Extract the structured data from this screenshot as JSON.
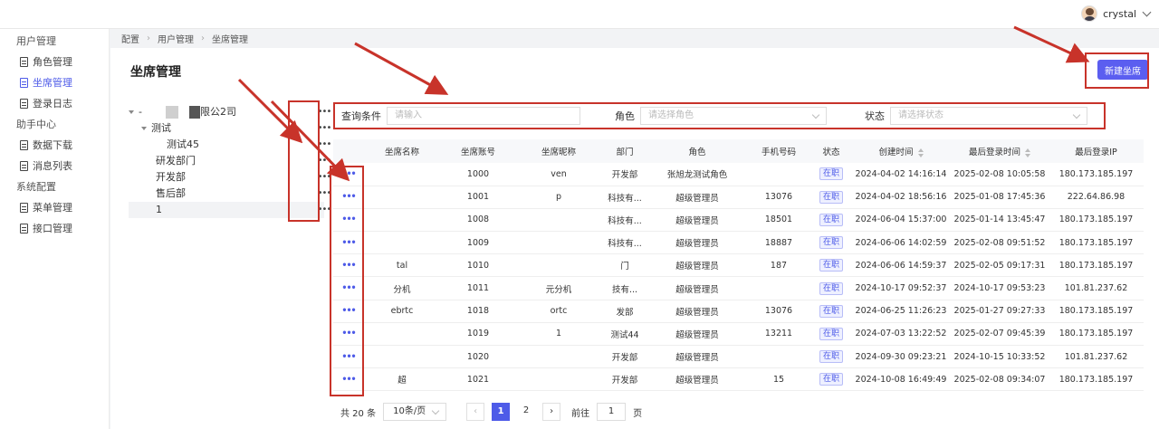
{
  "header": {
    "username": "crystal"
  },
  "sidebar": {
    "groups": [
      {
        "label": "用户管理",
        "items": [
          {
            "label": "角色管理",
            "active": false
          },
          {
            "label": "坐席管理",
            "active": true
          },
          {
            "label": "登录日志",
            "active": false
          }
        ]
      },
      {
        "label": "助手中心",
        "items": [
          {
            "label": "数据下载",
            "active": false
          },
          {
            "label": "消息列表",
            "active": false
          }
        ]
      },
      {
        "label": "系统配置",
        "items": [
          {
            "label": "菜单管理",
            "active": false
          },
          {
            "label": "接口管理",
            "active": false
          }
        ]
      }
    ]
  },
  "breadcrumb": [
    "配置",
    "用户管理",
    "坐席管理"
  ],
  "page": {
    "title": "坐席管理",
    "new_button": "新建坐席"
  },
  "tree": [
    {
      "label": "-",
      "suffix": "限公2司",
      "level": 0,
      "expanded": true,
      "selected": false
    },
    {
      "label": "测试",
      "level": 1,
      "expanded": true,
      "selected": false
    },
    {
      "label": "测试45",
      "level": 2,
      "selected": false
    },
    {
      "label": "研发部门",
      "level": 1,
      "selected": false
    },
    {
      "label": "开发部",
      "level": 1,
      "selected": false
    },
    {
      "label": "售后部",
      "level": 1,
      "selected": false
    },
    {
      "label": "1",
      "level": 1,
      "selected": true
    }
  ],
  "filter": {
    "query_label": "查询条件",
    "query_placeholder": "请输入",
    "role_label": "角色",
    "role_placeholder": "请选择角色",
    "status_label": "状态",
    "status_placeholder": "请选择状态"
  },
  "table": {
    "columns": [
      "",
      "坐席名称",
      "坐席账号",
      "坐席昵称",
      "部门",
      "角色",
      "手机号码",
      "状态",
      "创建时间",
      "最后登录时间",
      "最后登录IP"
    ],
    "rows": [
      {
        "more": "•••",
        "name": "",
        "account": "1000",
        "nickname": "ven",
        "dept": "开发部",
        "role": "张旭龙测试角色",
        "phone": "",
        "status": "在职",
        "created": "2024-04-02 14:16:14",
        "last_login": "2025-02-08 10:05:58",
        "ip": "180.173.185.197"
      },
      {
        "more": "•••",
        "name": "",
        "account": "1001",
        "nickname": "p",
        "dept": "科技有...",
        "role": "超级管理员",
        "phone": "13076",
        "status": "在职",
        "created": "2024-04-02 18:56:16",
        "last_login": "2025-01-08 17:45:36",
        "ip": "222.64.86.98"
      },
      {
        "more": "•••",
        "name": "",
        "account": "1008",
        "nickname": "",
        "dept": "科技有...",
        "role": "超级管理员",
        "phone": "18501",
        "status": "在职",
        "created": "2024-06-04 15:37:00",
        "last_login": "2025-01-14 13:45:47",
        "ip": "180.173.185.197"
      },
      {
        "more": "•••",
        "name": "",
        "account": "1009",
        "nickname": "",
        "dept": "科技有...",
        "role": "超级管理员",
        "phone": "18887",
        "status": "在职",
        "created": "2024-06-06 14:02:59",
        "last_login": "2025-02-08 09:51:52",
        "ip": "180.173.185.197"
      },
      {
        "more": "•••",
        "name": "tal",
        "account": "1010",
        "nickname": "",
        "dept": "门",
        "role": "超级管理员",
        "phone": "187",
        "status": "在职",
        "created": "2024-06-06 14:59:37",
        "last_login": "2025-02-05 09:17:31",
        "ip": "180.173.185.197"
      },
      {
        "more": "•••",
        "name": "分机",
        "account": "1011",
        "nickname": "元分机",
        "dept": "技有...",
        "role": "超级管理员",
        "phone": "",
        "status": "在职",
        "created": "2024-10-17 09:52:37",
        "last_login": "2024-10-17 09:53:23",
        "ip": "101.81.237.62"
      },
      {
        "more": "•••",
        "name": "ebrtc",
        "account": "1018",
        "nickname": "ortc",
        "dept": "发部",
        "role": "超级管理员",
        "phone": "13076",
        "status": "在职",
        "created": "2024-06-25 11:26:23",
        "last_login": "2025-01-27 09:27:33",
        "ip": "180.173.185.197"
      },
      {
        "more": "•••",
        "name": "",
        "account": "1019",
        "nickname": "1",
        "dept": "测试44",
        "role": "超级管理员",
        "phone": "13211",
        "status": "在职",
        "created": "2024-07-03 13:22:52",
        "last_login": "2025-02-07 09:45:39",
        "ip": "180.173.185.197"
      },
      {
        "more": "•••",
        "name": "",
        "account": "1020",
        "nickname": "",
        "dept": "开发部",
        "role": "超级管理员",
        "phone": "",
        "status": "在职",
        "created": "2024-09-30 09:23:21",
        "last_login": "2024-10-15 10:33:52",
        "ip": "101.81.237.62"
      },
      {
        "more": "•••",
        "name": "超",
        "account": "1021",
        "nickname": "",
        "dept": "开发部",
        "role": "超级管理员",
        "phone": "15",
        "status": "在职",
        "created": "2024-10-08 16:49:49",
        "last_login": "2025-02-08 09:34:07",
        "ip": "180.173.185.197"
      }
    ]
  },
  "pager": {
    "total": "共 20 条",
    "page_size": "10条/页",
    "pages": [
      "1",
      "2"
    ],
    "current": "1",
    "goto_label": "前往",
    "goto_value": "1",
    "page_unit": "页"
  },
  "colors": {
    "accent": "#5b5ef0",
    "annotation": "#c8332a"
  }
}
